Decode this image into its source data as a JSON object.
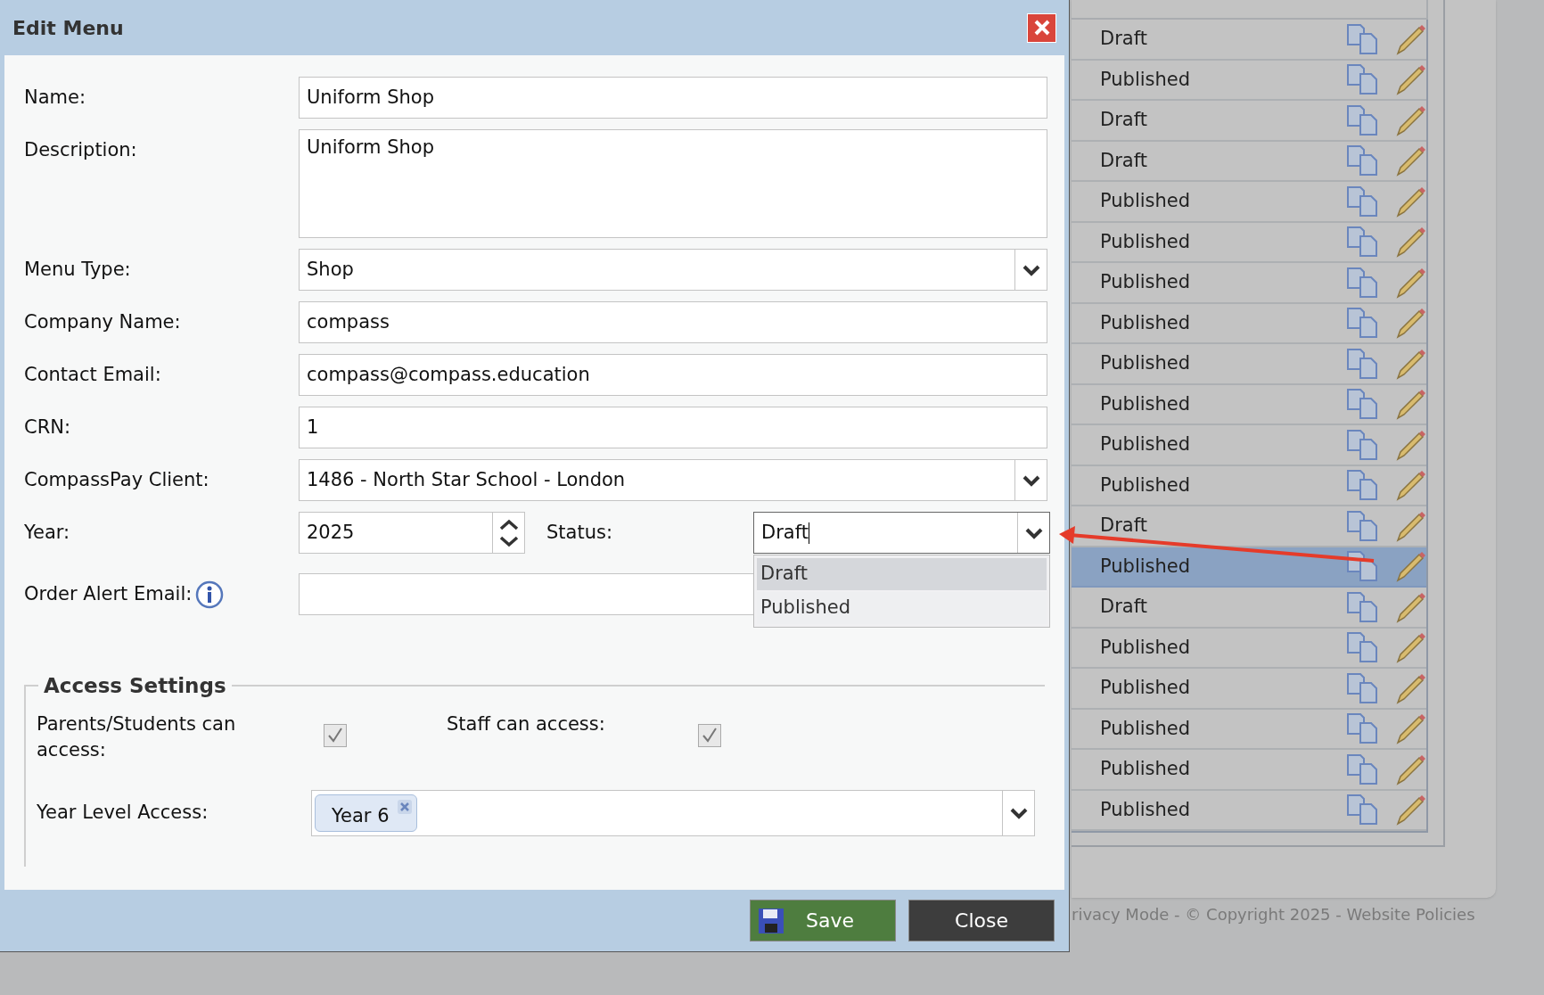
{
  "dialog": {
    "title": "Edit Menu",
    "fields": [
      {
        "kind": "text",
        "label": "Name:",
        "value": "Uniform Shop"
      },
      {
        "kind": "textarea",
        "label": "Description:",
        "value": "Uniform Shop"
      },
      {
        "kind": "select",
        "label": "Menu Type:",
        "value": "Shop"
      },
      {
        "kind": "text",
        "label": "Company Name:",
        "value": "compass"
      },
      {
        "kind": "text",
        "label": "Contact Email:",
        "value": "compass@compass.education"
      },
      {
        "kind": "text",
        "label": "CRN:",
        "value": "1"
      },
      {
        "kind": "select",
        "label": "CompassPay Client:",
        "value": "1486 - North Star School - London"
      }
    ],
    "year": {
      "label": "Year:",
      "value": "2025"
    },
    "status": {
      "label": "Status:",
      "value": "Draft",
      "expanded": true,
      "options": [
        {
          "label": "Draft",
          "selected": true
        },
        {
          "label": "Published",
          "selected": false
        }
      ]
    },
    "order_alert_email": {
      "label": "Order Alert Email:"
    },
    "access_settings": {
      "legend": "Access Settings",
      "parents": {
        "label": "Parents/Students can access:",
        "checked": true
      },
      "staff": {
        "label": "Staff can access:",
        "checked": true
      },
      "year_level": {
        "label": "Year Level Access:",
        "tags": [
          "Year 6"
        ]
      }
    },
    "buttons": [
      {
        "kind": "save",
        "label": "Save"
      },
      {
        "kind": "close",
        "label": "Close"
      }
    ]
  },
  "background_list": {
    "rows": [
      {
        "status": "Draft",
        "selected": false
      },
      {
        "status": "Published",
        "selected": false
      },
      {
        "status": "Draft",
        "selected": false
      },
      {
        "status": "Draft",
        "selected": false
      },
      {
        "status": "Published",
        "selected": false
      },
      {
        "status": "Published",
        "selected": false
      },
      {
        "status": "Published",
        "selected": false
      },
      {
        "status": "Published",
        "selected": false
      },
      {
        "status": "Published",
        "selected": false
      },
      {
        "status": "Published",
        "selected": false
      },
      {
        "status": "Published",
        "selected": false
      },
      {
        "status": "Published",
        "selected": false
      },
      {
        "status": "Draft",
        "selected": false
      },
      {
        "status": "Published",
        "selected": true
      },
      {
        "status": "Draft",
        "selected": false
      },
      {
        "status": "Published",
        "selected": false
      },
      {
        "status": "Published",
        "selected": false
      },
      {
        "status": "Published",
        "selected": false
      },
      {
        "status": "Published",
        "selected": false
      },
      {
        "status": "Published",
        "selected": false
      }
    ]
  },
  "footer_text": "rivacy Mode - © Copyright 2025 - Website Policies"
}
